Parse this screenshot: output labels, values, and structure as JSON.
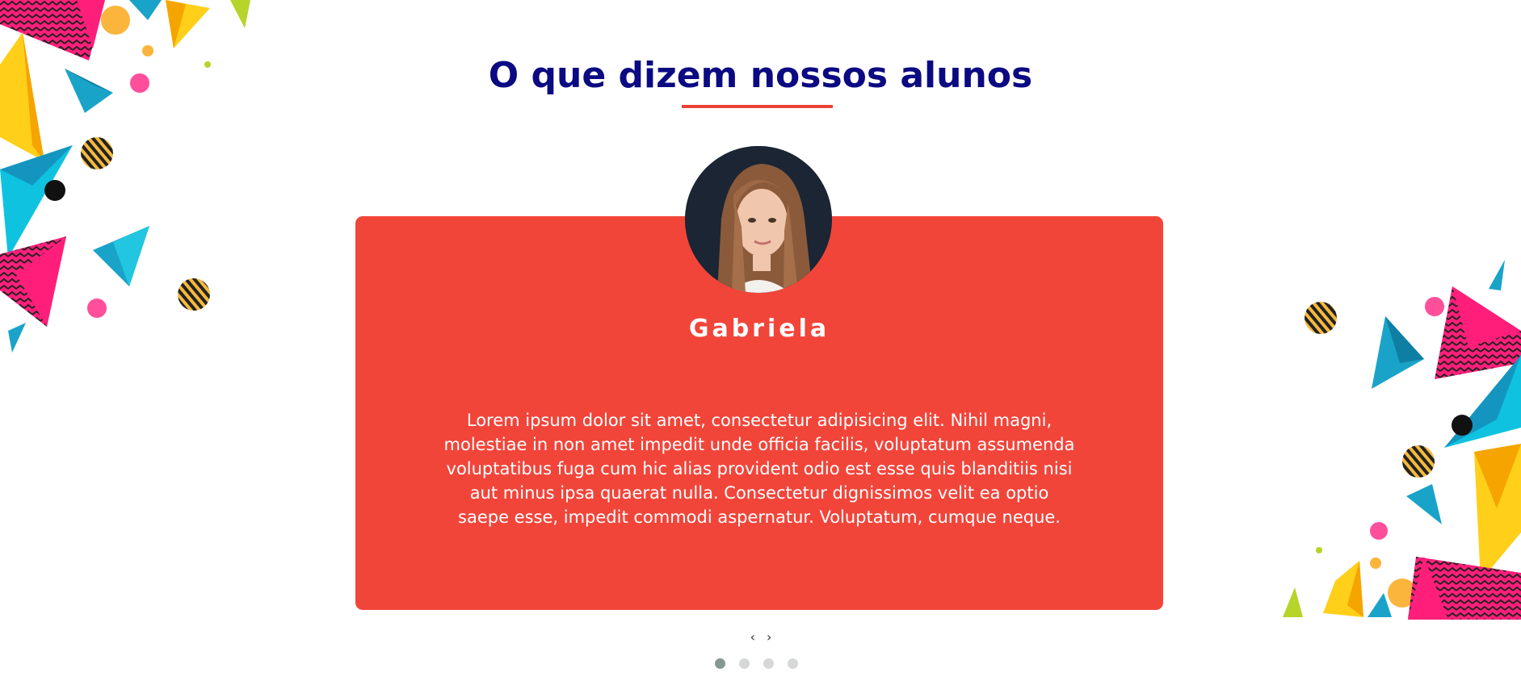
{
  "section": {
    "title": "O que dizem nossos alunos"
  },
  "testimonial": {
    "name": "Gabriela",
    "text": "Lorem ipsum dolor sit amet, consectetur adipisicing elit. Nihil magni, molestiae in non amet impedit unde officia facilis, voluptatum assumenda voluptatibus fuga cum hic alias provident odio est esse quis blanditiis nisi aut minus ipsa quaerat nulla. Consectetur dignissimos velit ea optio saepe esse, impedit commodi aspernatur. Voluptatum, cumque neque.",
    "avatar_icon": "student-photo"
  },
  "carousel": {
    "prev_label": "‹",
    "next_label": "›",
    "dots": [
      {
        "active": true
      },
      {
        "active": false
      },
      {
        "active": false
      },
      {
        "active": false
      }
    ]
  },
  "colors": {
    "title": "#0b0a82",
    "accent": "#ea4335",
    "card": "#f2453a",
    "dot_active": "#869791",
    "dot_inactive": "#d6d8d8"
  }
}
